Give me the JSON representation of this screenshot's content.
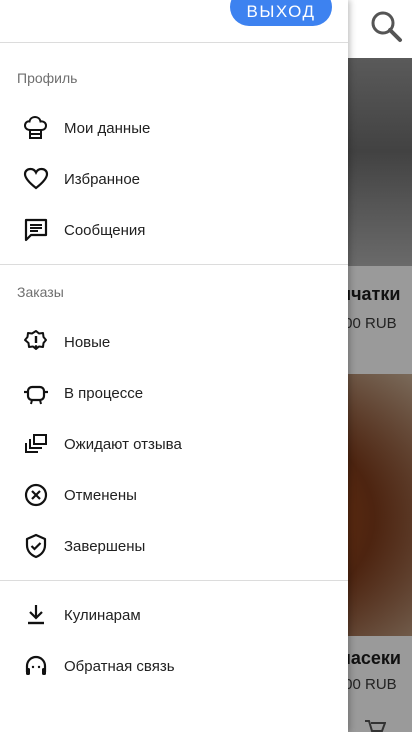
{
  "drawer": {
    "logout_label": "ВЫХОД",
    "sections": [
      {
        "header": "Профиль",
        "items": [
          {
            "label": "Мои данные",
            "icon": "chef-hat-icon"
          },
          {
            "label": "Избранное",
            "icon": "heart-icon"
          },
          {
            "label": "Сообщения",
            "icon": "message-icon"
          }
        ]
      },
      {
        "header": "Заказы",
        "items": [
          {
            "label": "Новые",
            "icon": "alert-badge-icon"
          },
          {
            "label": "В процессе",
            "icon": "cooking-pot-icon"
          },
          {
            "label": "Ожидают отзыва",
            "icon": "stacked-cards-icon"
          },
          {
            "label": "Отменены",
            "icon": "cancel-circle-icon"
          },
          {
            "label": "Завершены",
            "icon": "shield-check-icon"
          }
        ]
      },
      {
        "header": "",
        "items": [
          {
            "label": "Кулинарам",
            "icon": "download-icon"
          },
          {
            "label": "Обратная связь",
            "icon": "support-headset-icon"
          }
        ]
      }
    ]
  },
  "background": {
    "card1_title": "ичатки",
    "card1_price": ".00 RUB",
    "card2_title": "пасеки",
    "card2_price": ".00 RUB"
  },
  "colors": {
    "accent": "#3d82f0",
    "overlay": "#9e9e9e"
  }
}
